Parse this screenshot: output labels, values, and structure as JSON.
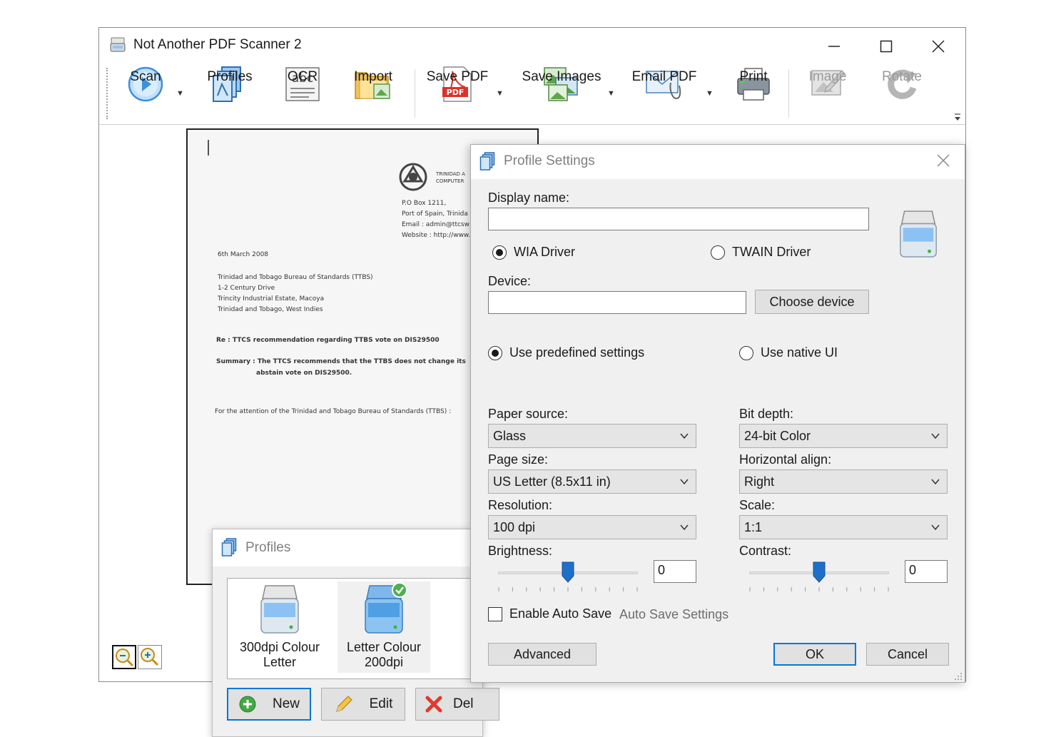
{
  "app": {
    "title": "Not Another PDF Scanner 2",
    "window_controls": [
      "minimize",
      "maximize",
      "close"
    ]
  },
  "toolbar": {
    "items": [
      {
        "label": "Scan",
        "icon": "scan-play-icon",
        "dropdown": true,
        "enabled": true
      },
      {
        "label": "Profiles",
        "icon": "profiles-icon",
        "dropdown": false,
        "enabled": true
      },
      {
        "label": "OCR",
        "icon": "ocr-abc-icon",
        "dropdown": false,
        "enabled": true
      },
      {
        "label": "Import",
        "icon": "folder-import-icon",
        "dropdown": false,
        "enabled": true
      },
      {
        "label": "Save PDF",
        "icon": "pdf-icon",
        "dropdown": true,
        "enabled": true
      },
      {
        "label": "Save Images",
        "icon": "images-icon",
        "dropdown": true,
        "enabled": true
      },
      {
        "label": "Email PDF",
        "icon": "email-icon",
        "dropdown": true,
        "enabled": true
      },
      {
        "label": "Print",
        "icon": "printer-icon",
        "dropdown": false,
        "enabled": true
      },
      {
        "label": "Image",
        "icon": "image-edit-icon",
        "dropdown": false,
        "enabled": false
      },
      {
        "label": "Rotate",
        "icon": "rotate-icon",
        "dropdown": false,
        "enabled": false
      }
    ],
    "pdf_badge": "PDF",
    "ocr_glyph": "abc"
  },
  "document": {
    "org_name": "TRINIDAD A",
    "org_name2": "COMPUTER",
    "address_lines": [
      "P.O Box 1211,",
      "Port of Spain, Trinida",
      "Email : admin@ttcsw",
      "Website : http://www."
    ],
    "date": "6th March 2008",
    "recipient_lines": [
      "Trinidad and Tobago Bureau of Standards (TTBS)",
      "1-2 Century Drive",
      "Trincity Industrial Estate, Macoya",
      "Trinidad and Tobago, West Indies"
    ],
    "re_line": "Re : TTCS recommendation regarding TTBS vote on DIS29500",
    "summary_line1": "Summary : The TTCS recommends that the TTBS does not change its",
    "summary_line2": "abstain vote on DIS29500.",
    "attention_line": "For the attention of the Trinidad and Tobago Bureau of Standards (TTBS) :"
  },
  "profiles_dialog": {
    "title": "Profiles",
    "items": [
      {
        "name": "300dpi Colour Letter",
        "line1": "300dpi Colour",
        "line2": "Letter",
        "default": false
      },
      {
        "name": "Letter Colour 200dpi",
        "line1": "Letter Colour",
        "line2": "200dpi",
        "default": true
      }
    ],
    "buttons": {
      "new": "New",
      "edit": "Edit",
      "delete": "Del"
    }
  },
  "settings_dialog": {
    "title": "Profile Settings",
    "display_name_label": "Display name:",
    "display_name_value": "",
    "driver_options": {
      "wia": "WIA Driver",
      "twain": "TWAIN Driver",
      "selected": "wia"
    },
    "device_label": "Device:",
    "device_value": "",
    "choose_device": "Choose device",
    "ui_options": {
      "predefined": "Use predefined settings",
      "native": "Use native UI",
      "selected": "predefined"
    },
    "paper_source": {
      "label": "Paper source:",
      "value": "Glass"
    },
    "page_size": {
      "label": "Page size:",
      "value": "US Letter (8.5x11 in)"
    },
    "resolution": {
      "label": "Resolution:",
      "value": "100 dpi"
    },
    "bit_depth": {
      "label": "Bit depth:",
      "value": "24-bit Color"
    },
    "horizontal_align": {
      "label": "Horizontal align:",
      "value": "Right"
    },
    "scale": {
      "label": "Scale:",
      "value": "1:1"
    },
    "brightness": {
      "label": "Brightness:",
      "value": "0",
      "level": 0.5
    },
    "contrast": {
      "label": "Contrast:",
      "value": "0",
      "level": 0.5
    },
    "auto_save": {
      "label": "Enable Auto Save",
      "checked": false,
      "settings_link": "Auto Save Settings"
    },
    "buttons": {
      "advanced": "Advanced",
      "ok": "OK",
      "cancel": "Cancel"
    }
  },
  "colors": {
    "accent": "#0078d7",
    "slider_thumb": "#1e6fc9",
    "disabled_text": "#9a9a9a",
    "dialog_bg": "#f0f0f0"
  }
}
